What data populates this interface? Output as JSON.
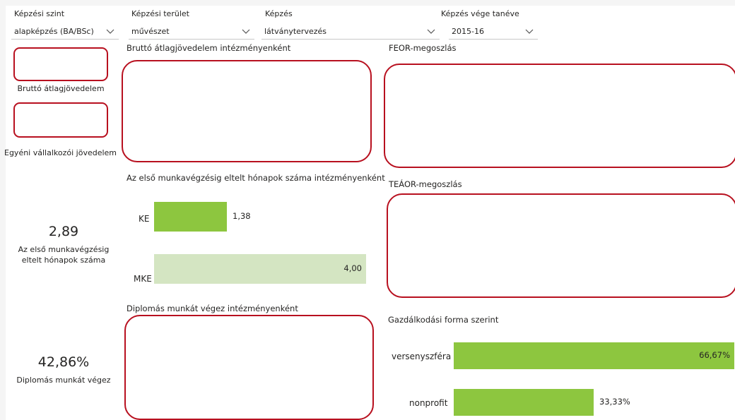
{
  "filters": [
    {
      "label": "Képzési szint",
      "value": "alapképzés (BA/BSc)"
    },
    {
      "label": "Képzési terület",
      "value": "művészet"
    },
    {
      "label": "Képzés",
      "value": "látványtervezés"
    },
    {
      "label": "Képzés vége tanéve",
      "value": "2015-16"
    }
  ],
  "left_kpis": {
    "income_label": "Bruttó átlagjövedelem",
    "self_employed_label": "Egyéni vállalkozói jövedelem",
    "months_value": "2,89",
    "months_label_line1": "Az első munkavégzésig",
    "months_label_line2": "eltelt hónapok száma",
    "grad_value": "42,86%",
    "grad_label": "Diplomás munkát végez"
  },
  "visual_titles": {
    "income_by_institution": "Bruttó átlagjövedelem intézményenként",
    "feor": "FEOR-megoszlás",
    "months_by_institution": "Az első munkavégzésig eltelt hónapok száma intézményenként",
    "teaor": "TEÁOR-megoszlás",
    "grad_by_institution": "Diplomás munkát végez intézményenként",
    "economic_form": "Gazdálkodási forma szerint"
  },
  "chart_data": [
    {
      "type": "bar",
      "orientation": "horizontal",
      "title": "Az első munkavégzésig eltelt hónapok száma intézményenként",
      "categories": [
        "KE",
        "MKE"
      ],
      "values": [
        1.38,
        4.0
      ],
      "value_labels": [
        "1,38",
        "4,00"
      ],
      "xlim": [
        0,
        4.0
      ],
      "colors": [
        "#8dc63f",
        "#d4e5c2"
      ]
    },
    {
      "type": "bar",
      "orientation": "horizontal",
      "title": "Gazdálkodási forma szerint",
      "categories": [
        "versenyszféra",
        "nonprofit"
      ],
      "values": [
        66.67,
        33.33
      ],
      "value_labels": [
        "66,67%",
        "33,33%"
      ],
      "xlim": [
        0,
        66.67
      ],
      "colors": [
        "#8dc63f",
        "#8dc63f"
      ]
    }
  ],
  "colors": {
    "accent_green": "#8dc63f",
    "light_green": "#d4e5c2",
    "highlight_red": "#b8101f"
  }
}
